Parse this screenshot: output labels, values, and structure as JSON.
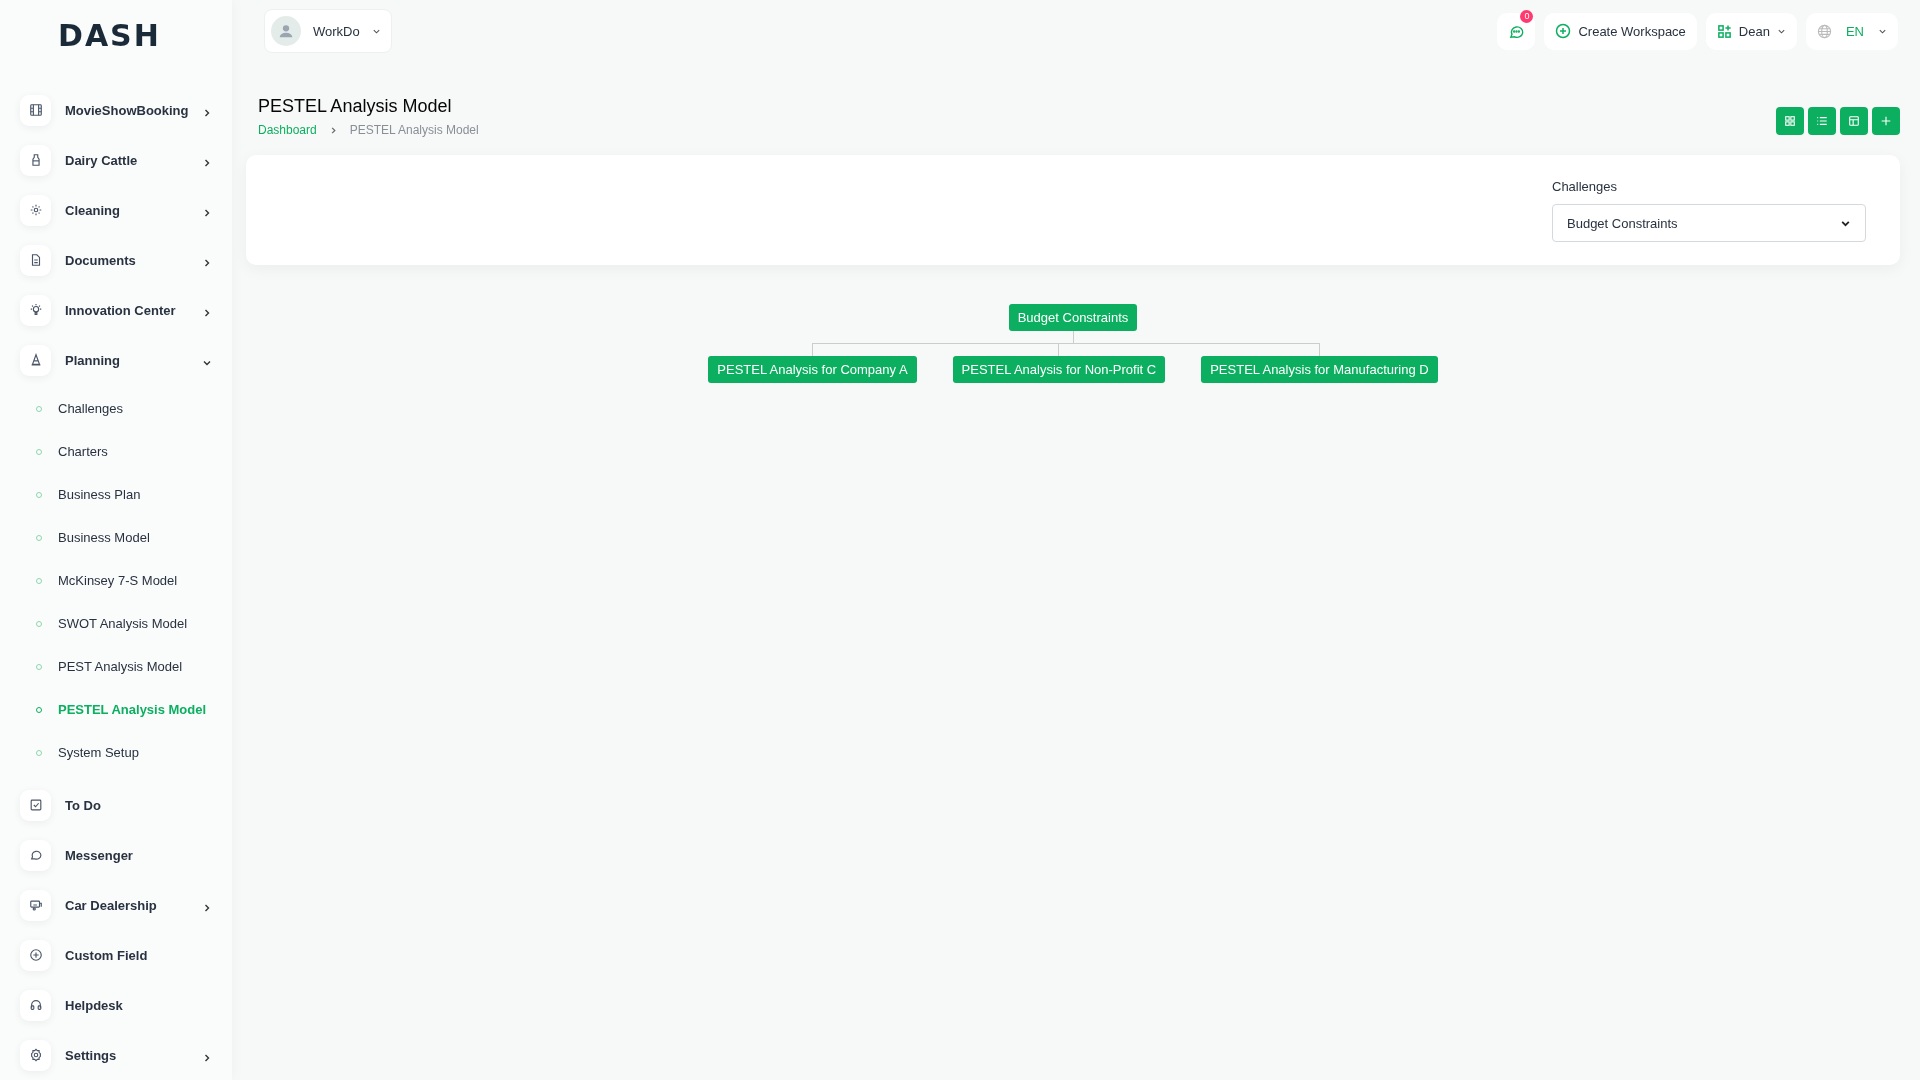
{
  "logo": "DASH",
  "workspace": {
    "name": "WorkDo"
  },
  "header": {
    "notifications": "0",
    "create_workspace": "Create Workspace",
    "user": "Dean",
    "language": "EN"
  },
  "sidebar": {
    "items": [
      {
        "label": "MovieShowBooking",
        "has_children": true,
        "expanded": false
      },
      {
        "label": "Dairy Cattle",
        "has_children": true,
        "expanded": false
      },
      {
        "label": "Cleaning",
        "has_children": true,
        "expanded": false
      },
      {
        "label": "Documents",
        "has_children": true,
        "expanded": false
      },
      {
        "label": "Innovation Center",
        "has_children": true,
        "expanded": false
      },
      {
        "label": "Planning",
        "has_children": true,
        "expanded": true,
        "children": [
          {
            "label": "Challenges",
            "selected": false
          },
          {
            "label": "Charters",
            "selected": false
          },
          {
            "label": "Business Plan",
            "selected": false
          },
          {
            "label": "Business Model",
            "selected": false
          },
          {
            "label": "McKinsey 7-S Model",
            "selected": false
          },
          {
            "label": "SWOT Analysis Model",
            "selected": false
          },
          {
            "label": "PEST Analysis Model",
            "selected": false
          },
          {
            "label": "PESTEL Analysis Model",
            "selected": true
          },
          {
            "label": "System Setup",
            "selected": false
          }
        ]
      },
      {
        "label": "To Do",
        "has_children": false
      },
      {
        "label": "Messenger",
        "has_children": false
      },
      {
        "label": "Car Dealership",
        "has_children": true,
        "expanded": false
      },
      {
        "label": "Custom Field",
        "has_children": false
      },
      {
        "label": "Helpdesk",
        "has_children": false
      },
      {
        "label": "Settings",
        "has_children": true,
        "expanded": false
      }
    ]
  },
  "page": {
    "title": "PESTEL Analysis Model",
    "breadcrumb": [
      "Dashboard",
      "PESTEL Analysis Model"
    ]
  },
  "filter": {
    "label": "Challenges",
    "value": "Budget Constraints"
  },
  "tree": {
    "label": "Budget Constraints",
    "children": [
      {
        "label": "PESTEL Analysis for Company A"
      },
      {
        "label": "PESTEL Analysis for Non-Profit C"
      },
      {
        "label": "PESTEL Analysis for Manufacturing D"
      }
    ]
  }
}
